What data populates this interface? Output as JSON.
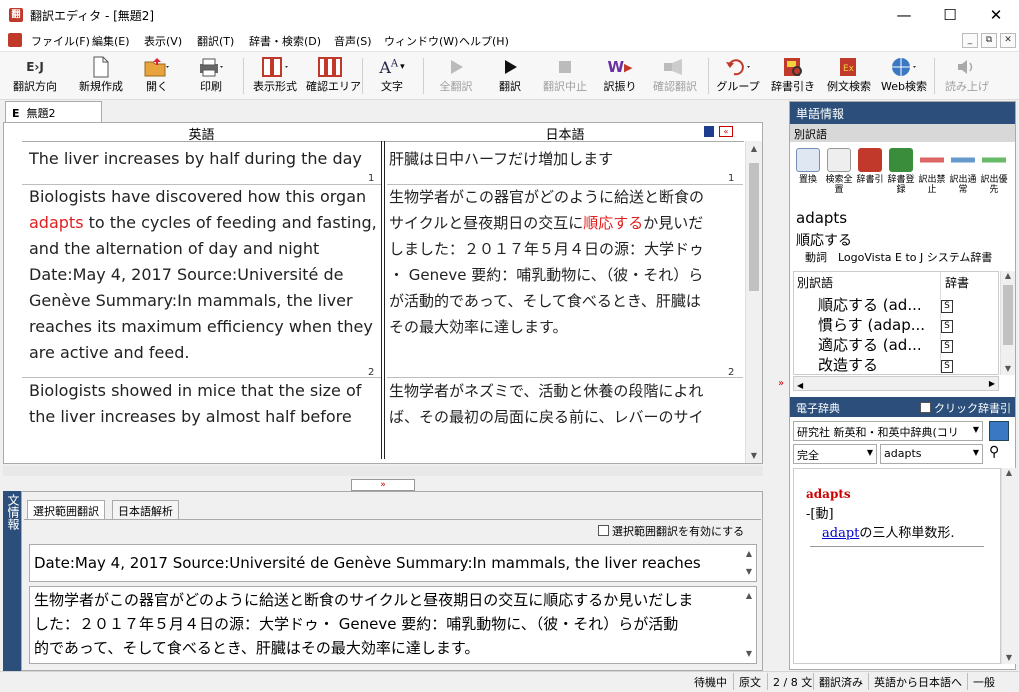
{
  "window": {
    "title": "翻訳エディタ - [無題2]",
    "app_icon": "翻"
  },
  "menu": [
    "ファイル(F)",
    "編集(E)",
    "表示(V)",
    "翻訳(T)",
    "辞書・検索(D)",
    "音声(S)",
    "ウィンドウ(W)",
    "ヘルプ(H)"
  ],
  "toolbar": {
    "direction": "翻訳方向",
    "direction_badge": "E›J",
    "new": "新規作成",
    "open": "開く",
    "print": "印刷",
    "display_format": "表示形式",
    "confirm_area": "確認エリア",
    "text": "文字",
    "translate_all": "全翻訳",
    "translate": "翻訳",
    "stop": "翻訳中止",
    "assign": "訳振り",
    "confirm_translate": "確認翻訳",
    "group": "グループ",
    "dict_lookup": "辞書引き",
    "example_search": "例文検索",
    "web_search": "Web検索",
    "read_aloud": "読み上げ"
  },
  "document_tab": {
    "prefix": "E",
    "name": "無題2"
  },
  "editor": {
    "source_header": "英語",
    "target_header": "日本語",
    "rows": [
      {
        "num": "1",
        "source_lines": [
          "The liver increases by half during the day"
        ],
        "target_lines": [
          "肝臓は日中ハーフだけ増加します"
        ]
      },
      {
        "num": "2",
        "source_pre": "Biologists have discovered how this organ",
        "source_highlight": "adapts",
        "source_post": " to the cycles of feeding and fasting,",
        "source_rest": [
          "and the alternation of day and night",
          "Date:May 4, 2017 Source:Université de",
          "Genève Summary:In mammals, the liver",
          "reaches its maximum efficiency when they",
          "are active and feed."
        ],
        "target_first": "生物学者がこの器官がどのように給送と断食の",
        "target_pre": "サイクルと昼夜期日の交互に",
        "target_highlight": "順応する",
        "target_post": "か見いだ",
        "target_rest": [
          "しました：２０１７年５月４日の源：大学ドゥ",
          "・ Geneve 要約：哺乳動物に、（彼・それ）ら",
          "が活動的であって、そして食べるとき、肝臓は",
          "その最大効率に達します。"
        ]
      },
      {
        "num": "",
        "source_lines": [
          "Biologists showed in mice that the size of",
          "the liver increases by almost half before"
        ],
        "target_lines": [
          "生物学者がネズミで、活動と休養の段階によれ",
          "ば、その最初の局面に戻る前に、レバーのサイ"
        ]
      }
    ]
  },
  "info_sidebar": "文情報",
  "lower": {
    "tabs": [
      "選択範囲翻訳",
      "日本語解析"
    ],
    "enable_selection": "選択範囲翻訳を有効にする",
    "source": "Date:May 4, 2017 Source:Université de Genève Summary:In mammals, the liver reaches",
    "target_lines": [
      "生物学者がこの器官がどのように給送と断食のサイクルと昼夜期日の交互に順応するか見いだしま",
      "した：２０１７年５月４日の源：大学ドゥ・ Geneve 要約：哺乳動物に、（彼・それ）らが活動",
      "的であって、そして食べるとき、肝臓はその最大効率に達します。"
    ]
  },
  "word_info": {
    "title": "単語情報",
    "sub_title": "別訳語",
    "buttons": [
      "置換",
      "検索全置",
      "辞書引",
      "辞書登録",
      "訳出禁止",
      "訳出通常",
      "訳出優先"
    ],
    "word": "adapts",
    "translation": "順応する",
    "pos_line": "動詞　LogoVista E to J システム辞書",
    "list_headers": [
      "別訳語",
      "辞書"
    ],
    "alternatives": [
      "順応する (ad...",
      "慣らす (adap...",
      "適応する (ad...",
      "改造する"
    ],
    "dict_symbol": "S"
  },
  "e_dict": {
    "title": "電子辞典",
    "click_lookup": "クリック辞書引",
    "dictionary": "研究社 新英和・和英中辞典(コリ",
    "match": "完全",
    "query": "adapts",
    "headword": "adapts",
    "pos": "-[動]",
    "link": "adapt",
    "definition": "の三人称単数形."
  },
  "status": [
    "待機中",
    "原文",
    "2 / 8 文",
    "翻訳済み",
    "英語から日本語へ",
    "一般"
  ],
  "colors": {
    "accent": "#2b4f7a",
    "highlight": "#e02020",
    "link": "#0000cc"
  }
}
